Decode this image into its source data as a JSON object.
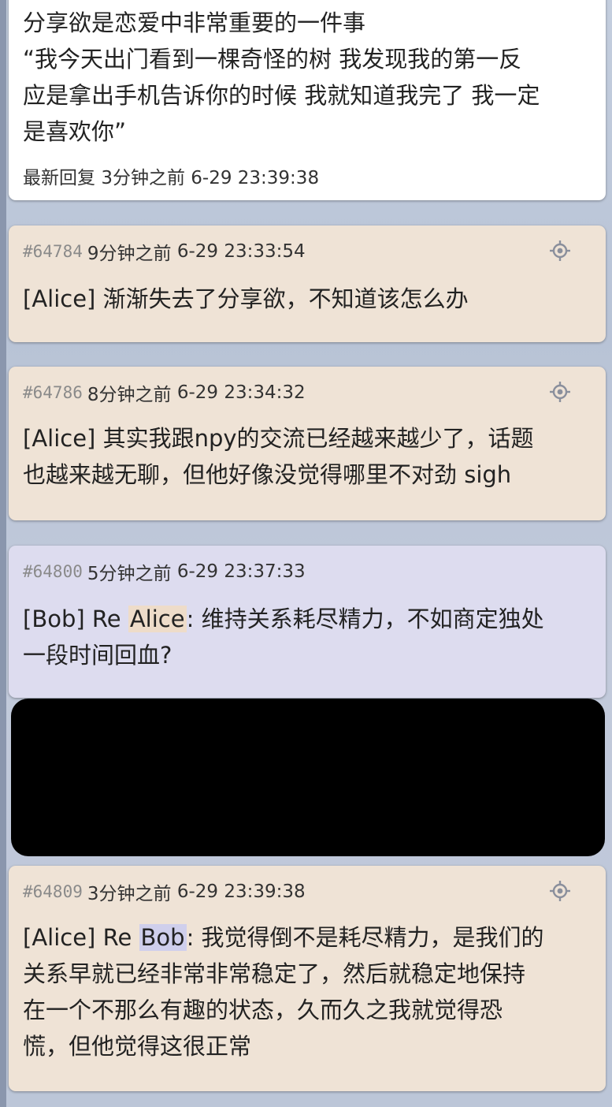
{
  "post": {
    "lines": [
      "分享欲是恋爱中非常重要的一件事",
      "“我今天出门看到一棵奇怪的树 我发现我的第一反",
      "应是拿出手机告诉你的时候 我就知道我完了 我一定",
      "是喜欢你”"
    ],
    "last_reply_label": "最新回复",
    "last_reply_ago": "3分钟之前",
    "last_reply_time": "6-29 23:39:38"
  },
  "replies": [
    {
      "pid": "#64784",
      "ago": "9分钟之前",
      "time": "6-29 23:33:54",
      "author": "[Alice]",
      "text": " 渐渐失去了分享欲，不知道该怎么办"
    },
    {
      "pid": "#64786",
      "ago": "8分钟之前",
      "time": "6-29 23:34:32",
      "author": "[Alice]",
      "text_line1": " 其实我跟npy的交流已经越来越少了，话题",
      "text_line2": "也越来越无聊，但他好像没觉得哪里不对劲 sigh"
    },
    {
      "pid": "#64800",
      "ago": "5分钟之前",
      "time": "6-29 23:37:33",
      "author": "[Bob]",
      "re": " Re ",
      "mention": "Alice",
      "text_line1": ": 维持关系耗尽精力，不如商定独处",
      "text_line2": "一段时间回血?"
    },
    {
      "pid": "#64809",
      "ago": "3分钟之前",
      "time": "6-29 23:39:38",
      "author": "[Alice]",
      "re": " Re ",
      "mention": "Bob",
      "text_line1": ": 我觉得倒不是耗尽精力，是我们的",
      "text_line2": "关系早就已经非常非常稳定了，然后就稳定地保持",
      "text_line3": "在一个不那么有趣的状态，久而久之我就觉得恐",
      "text_line4": "慌，但他觉得这很正常"
    }
  ],
  "colors": {
    "alice_card": "#efe3d6",
    "bob_card": "#dddcef",
    "alice_highlight": "#eedcc9",
    "bob_highlight": "#cfcfec",
    "redaction": "#000000"
  },
  "icons": {
    "locate": "crosshair-target-icon"
  }
}
